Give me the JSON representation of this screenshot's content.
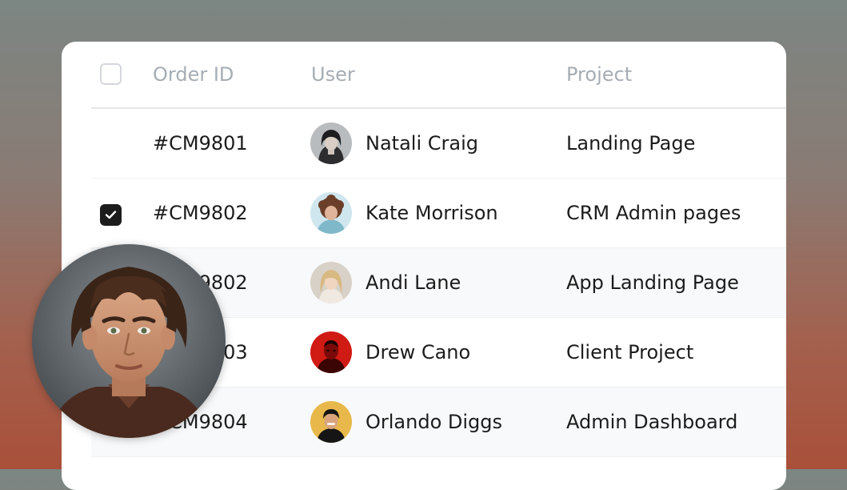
{
  "table": {
    "columns": {
      "order_id": "Order ID",
      "user": "User",
      "project": "Project"
    },
    "rows": [
      {
        "order_id": "#CM9801",
        "user": "Natali Craig",
        "project": "Landing Page",
        "checked": false
      },
      {
        "order_id": "#CM9802",
        "user": "Kate Morrison",
        "project": "CRM Admin pages",
        "checked": true
      },
      {
        "order_id": "#CM9802",
        "user": "Andi Lane",
        "project": "App Landing Page",
        "checked": false
      },
      {
        "order_id": "#CM9803",
        "user": "Drew Cano",
        "project": "Client Project",
        "checked": false
      },
      {
        "order_id": "#CM9804",
        "user": "Orlando Diggs",
        "project": "Admin Dashboard",
        "checked": false
      }
    ]
  },
  "colors": {
    "background_top": "#7c8683",
    "background_bottom": "#a9503a",
    "card": "#ffffff",
    "header_text": "#a6adb3",
    "body_text": "#1c1c1c",
    "checkbox_checked": "#1c1c1c",
    "row_alt": "#f8f9fa"
  },
  "icons": {
    "checkmark": "check-icon"
  }
}
